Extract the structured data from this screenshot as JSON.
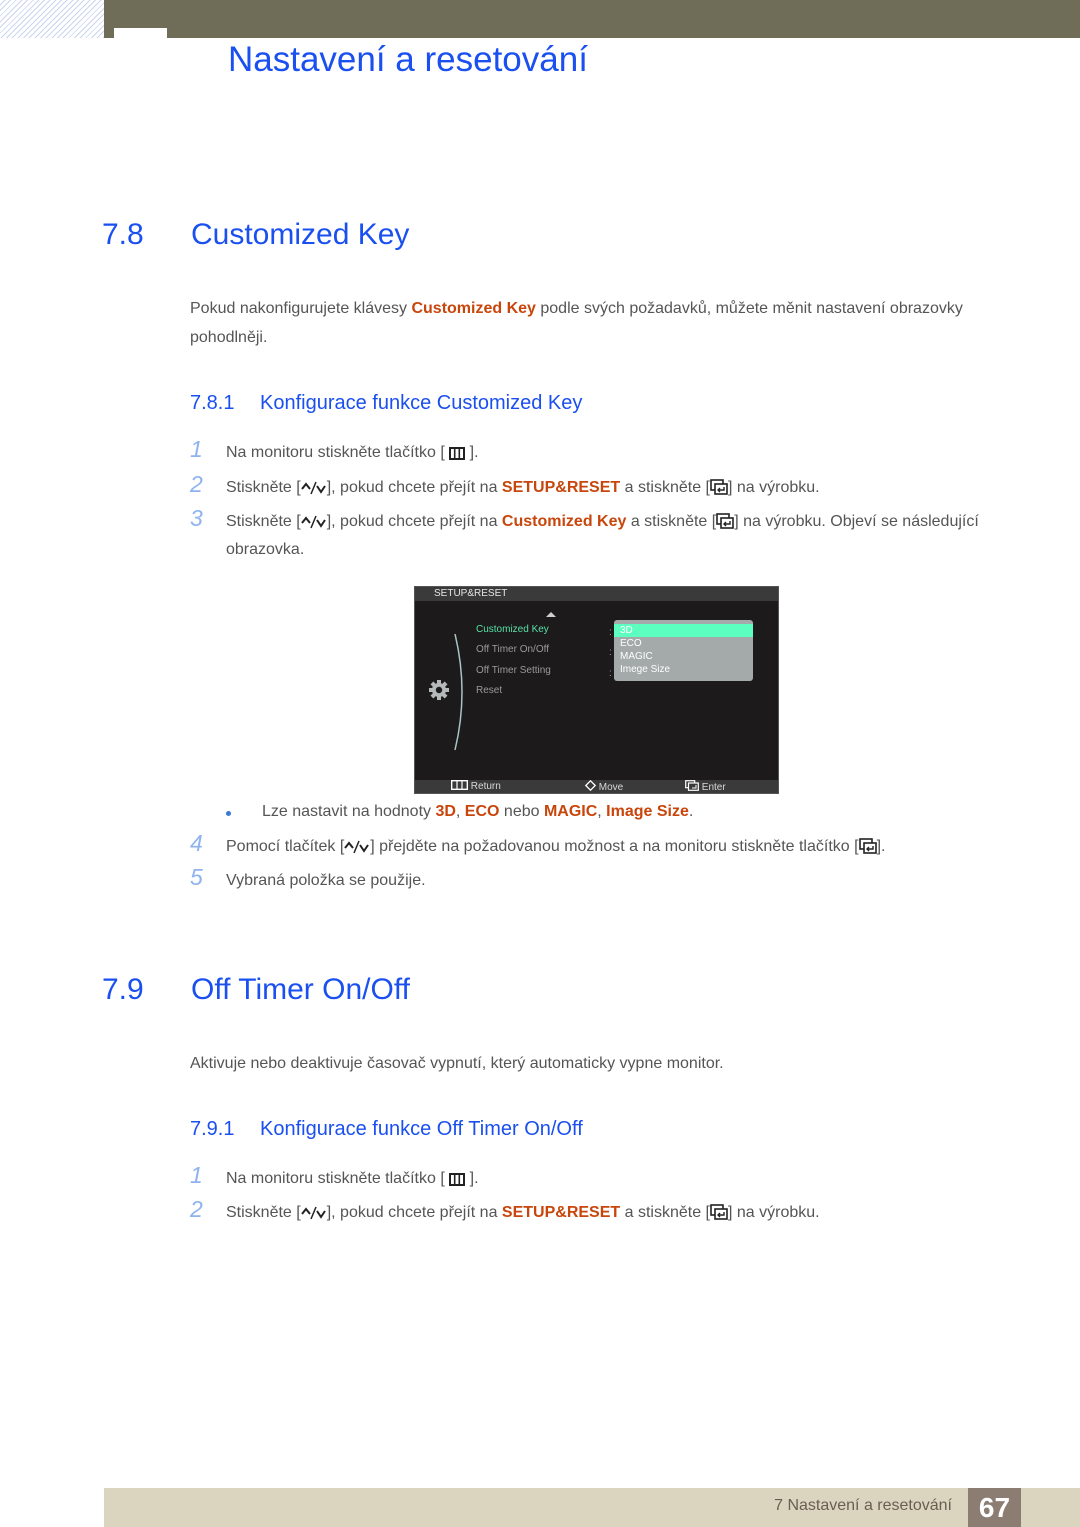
{
  "header": {
    "chapter_title": "Nastavení a resetování"
  },
  "section_7_8": {
    "number": "7.8",
    "title": "Customized Key",
    "intro": {
      "pre": "Pokud nakonfigurujete klávesy ",
      "highlight": "Customized Key",
      "post": " podle svých požadavků, můžete měnit nastavení obrazovky pohodlněji."
    },
    "subsection": {
      "number": "7.8.1",
      "title": "Konfigurace funkce Customized Key"
    },
    "steps": [
      {
        "num": "1",
        "pre": "Na monitoru stiskněte tlačítko [ ",
        "icon": "menu-icon",
        "post": " ]."
      },
      {
        "num": "2",
        "pre": "Stiskněte [",
        "icon": "up-down-icon",
        "mid": "], pokud chcete přejít na ",
        "highlight": "SETUP&RESET",
        "mid2": " a stiskněte [",
        "icon2": "enter-icon",
        "post": "] na výrobku."
      },
      {
        "num": "3",
        "pre": "Stiskněte [",
        "icon": "up-down-icon",
        "mid": "], pokud chcete přejít na ",
        "highlight": "Customized Key",
        "mid2": " a stiskněte [",
        "icon2": "enter-icon",
        "post": "] na výrobku. Objeví se následující obrazovka."
      },
      {
        "num": "4",
        "pre": "Pomocí tlačítek [",
        "icon": "up-down-icon",
        "mid": "] přejděte na požadovanou možnost a na monitoru stiskněte tlačítko [",
        "icon2": "enter-icon",
        "post": "]."
      },
      {
        "num": "5",
        "text": "Vybraná položka se použije."
      }
    ],
    "bullet": {
      "pre": "Lze nastavit na hodnoty ",
      "v1": "3D",
      "sep1": ", ",
      "v2": "ECO",
      "sep2": " nebo ",
      "v3": "MAGIC",
      "sep3": ", ",
      "v4": "Image Size",
      "post": "."
    },
    "osd": {
      "header": "SETUP&RESET",
      "menu_items": [
        "Customized Key",
        "Off Timer On/Off",
        "Off Timer Setting",
        "Reset"
      ],
      "selected_item": "Customized Key",
      "dropdown_options": [
        "3D",
        "ECO",
        "MAGIC",
        "Imege Size"
      ],
      "selected_option": "3D",
      "footer": {
        "return": "Return",
        "move": "Move",
        "enter": "Enter"
      },
      "colors": {
        "selected_item": "#57e0a8",
        "selected_option": "#5cffc0",
        "dropdown_bg": "#a3aaa9"
      }
    }
  },
  "section_7_9": {
    "number": "7.9",
    "title": "Off Timer On/Off",
    "intro": "Aktivuje nebo deaktivuje časovač vypnutí, který automaticky vypne monitor.",
    "subsection": {
      "number": "7.9.1",
      "title": "Konfigurace funkce Off Timer On/Off"
    },
    "steps": [
      {
        "num": "1",
        "pre": "Na monitoru stiskněte tlačítko [ ",
        "icon": "menu-icon",
        "post": " ]."
      },
      {
        "num": "2",
        "pre": "Stiskněte [",
        "icon": "up-down-icon",
        "mid": "], pokud chcete přejít na ",
        "highlight": "SETUP&RESET",
        "mid2": " a stiskněte [",
        "icon2": "enter-icon",
        "post": "] na výrobku."
      }
    ]
  },
  "footer": {
    "chapter": "7 Nastavení a resetování",
    "page": "67"
  },
  "colors": {
    "heading": "#1a4ff0",
    "highlight": "#c8460c",
    "step_number": "#8fb3f0",
    "top_bar": "#6f6d58",
    "footer_bar": "#dbd5bf",
    "page_box": "#8b7d72"
  }
}
